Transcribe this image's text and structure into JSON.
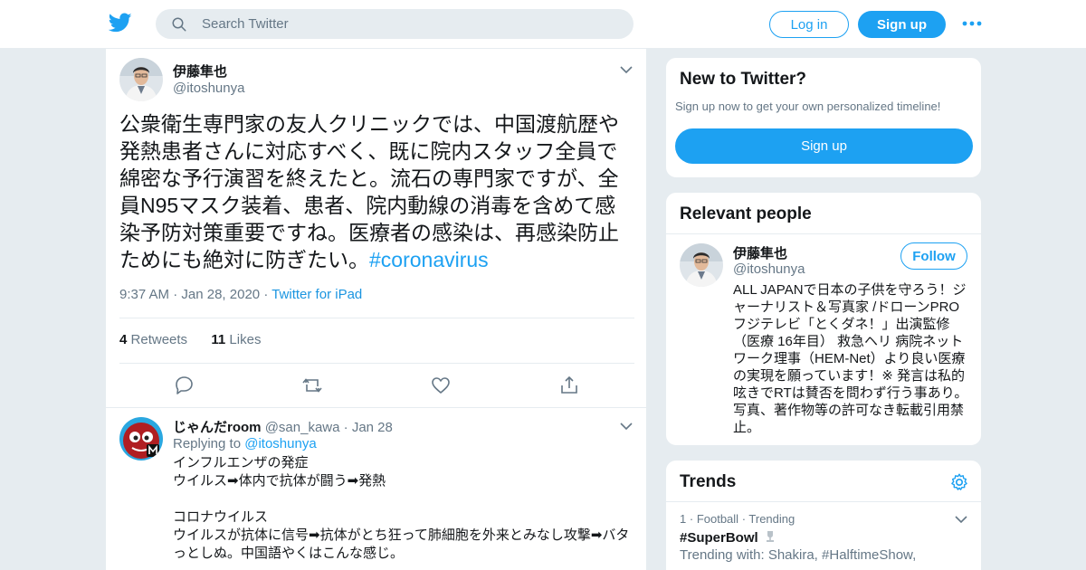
{
  "header": {
    "search_placeholder": "Search Twitter",
    "login_label": "Log in",
    "signup_label": "Sign up"
  },
  "tweet": {
    "name": "伊藤隼也",
    "handle": "@itoshunya",
    "text": "公衆衛生専門家の友人クリニックでは、中国渡航歴や発熱患者さんに対応すべく、既に院内スタッフ全員で綿密な予行演習を終えたと。流石の専門家ですが、全員N95マスク装着、患者、院内動線の消毒を含めて感染予防対策重要ですね。医療者の感染は、再感染防止ためにも絶対に防ぎたい。",
    "hashtag": "#coronavirus",
    "time": "9:37 AM",
    "date": "Jan 28, 2020",
    "source": "Twitter for iPad",
    "retweets_count": "4",
    "retweets_label": "Retweets",
    "likes_count": "11",
    "likes_label": "Likes"
  },
  "reply": {
    "name": "じゃんだroom",
    "handle": "@san_kawa",
    "date": "Jan 28",
    "replying_label": "Replying to",
    "replying_to": "@itoshunya",
    "text": "インフルエンザの発症\nウイルス➡体内で抗体が闘う➡発熱\n\nコロナウイルス\nウイルスが抗体に信号➡抗体がとち狂って肺細胞を外来とみなし攻撃➡バタっとしぬ。中国語やくはこんな感じ。"
  },
  "new_to_twitter": {
    "title": "New to Twitter?",
    "subtitle": "Sign up now to get your own personalized timeline!",
    "button": "Sign up"
  },
  "relevant_people": {
    "title": "Relevant people",
    "name": "伊藤隼也",
    "handle": "@itoshunya",
    "follow_label": "Follow",
    "bio": "ALL JAPANで日本の子供を守ろう！ジャーナリスト＆写真家 /ドローンPRO フジテレビ「とくダネ！」出演監修（医療 16年目） 救急ヘリ 病院ネットワーク理事（HEM-Net）より良い医療の実現を願っています！※ 発言は私的呟きでRTは賛否を問わず行う事あり。写真、著作物等の許可なき転載引用禁止。"
  },
  "trends": {
    "title": "Trends",
    "items": [
      {
        "rank": "1",
        "category": "Football",
        "status": "Trending",
        "name": "#SuperBowl",
        "with": "Trending with: Shakira, #HalftimeShow,"
      }
    ]
  }
}
